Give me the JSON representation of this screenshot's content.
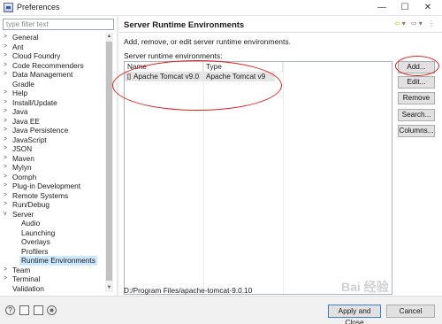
{
  "window": {
    "title": "Preferences"
  },
  "window_controls": {
    "minimize": "—",
    "maximize": "☐",
    "close": "✕"
  },
  "filter": {
    "placeholder": "type filter text"
  },
  "tree": [
    {
      "label": "General",
      "arrow": ">",
      "child": false
    },
    {
      "label": "Ant",
      "arrow": ">",
      "child": false
    },
    {
      "label": "Cloud Foundry",
      "arrow": ">",
      "child": false
    },
    {
      "label": "Code Recommenders",
      "arrow": ">",
      "child": false
    },
    {
      "label": "Data Management",
      "arrow": ">",
      "child": false
    },
    {
      "label": "Gradle",
      "arrow": "",
      "child": false
    },
    {
      "label": "Help",
      "arrow": ">",
      "child": false
    },
    {
      "label": "Install/Update",
      "arrow": ">",
      "child": false
    },
    {
      "label": "Java",
      "arrow": ">",
      "child": false
    },
    {
      "label": "Java EE",
      "arrow": ">",
      "child": false
    },
    {
      "label": "Java Persistence",
      "arrow": ">",
      "child": false
    },
    {
      "label": "JavaScript",
      "arrow": ">",
      "child": false
    },
    {
      "label": "JSON",
      "arrow": ">",
      "child": false
    },
    {
      "label": "Maven",
      "arrow": ">",
      "child": false
    },
    {
      "label": "Mylyn",
      "arrow": ">",
      "child": false
    },
    {
      "label": "Oomph",
      "arrow": ">",
      "child": false
    },
    {
      "label": "Plug-in Development",
      "arrow": ">",
      "child": false
    },
    {
      "label": "Remote Systems",
      "arrow": ">",
      "child": false
    },
    {
      "label": "Run/Debug",
      "arrow": ">",
      "child": false
    },
    {
      "label": "Server",
      "arrow": "v",
      "child": false
    },
    {
      "label": "Audio",
      "arrow": "",
      "child": true
    },
    {
      "label": "Launching",
      "arrow": "",
      "child": true
    },
    {
      "label": "Overlays",
      "arrow": "",
      "child": true
    },
    {
      "label": "Profilers",
      "arrow": "",
      "child": true
    },
    {
      "label": "Runtime Environments",
      "arrow": "",
      "child": true,
      "selected": true
    },
    {
      "label": "Team",
      "arrow": ">",
      "child": false
    },
    {
      "label": "Terminal",
      "arrow": ">",
      "child": false
    },
    {
      "label": "Validation",
      "arrow": "",
      "child": false
    }
  ],
  "scrollbar": {
    "up": "▲",
    "down": "▼"
  },
  "page": {
    "heading": "Server Runtime Environments",
    "nav_icons": {
      "back": "⇦",
      "back_menu": "▾",
      "forward": "⇨",
      "forward_menu": "▾",
      "menu": "⋮"
    },
    "description": "Add, remove, or edit server runtime environments.",
    "list_label": "Server runtime environments:",
    "columns": {
      "name": "Name",
      "type": "Type"
    },
    "rows": [
      {
        "name": "Apache Tomcat v9.0",
        "type": "Apache Tomcat v9"
      }
    ],
    "path": "D:/Program Files/apache-tomcat-9.0.10"
  },
  "buttons": {
    "add": "Add...",
    "edit": "Edit...",
    "remove": "Remove",
    "search": "Search...",
    "columns": "Columns..."
  },
  "bottom": {
    "help_glyph": "?",
    "apply_close": "Apply and Close",
    "cancel": "Cancel"
  },
  "watermark": "Bai 经验"
}
